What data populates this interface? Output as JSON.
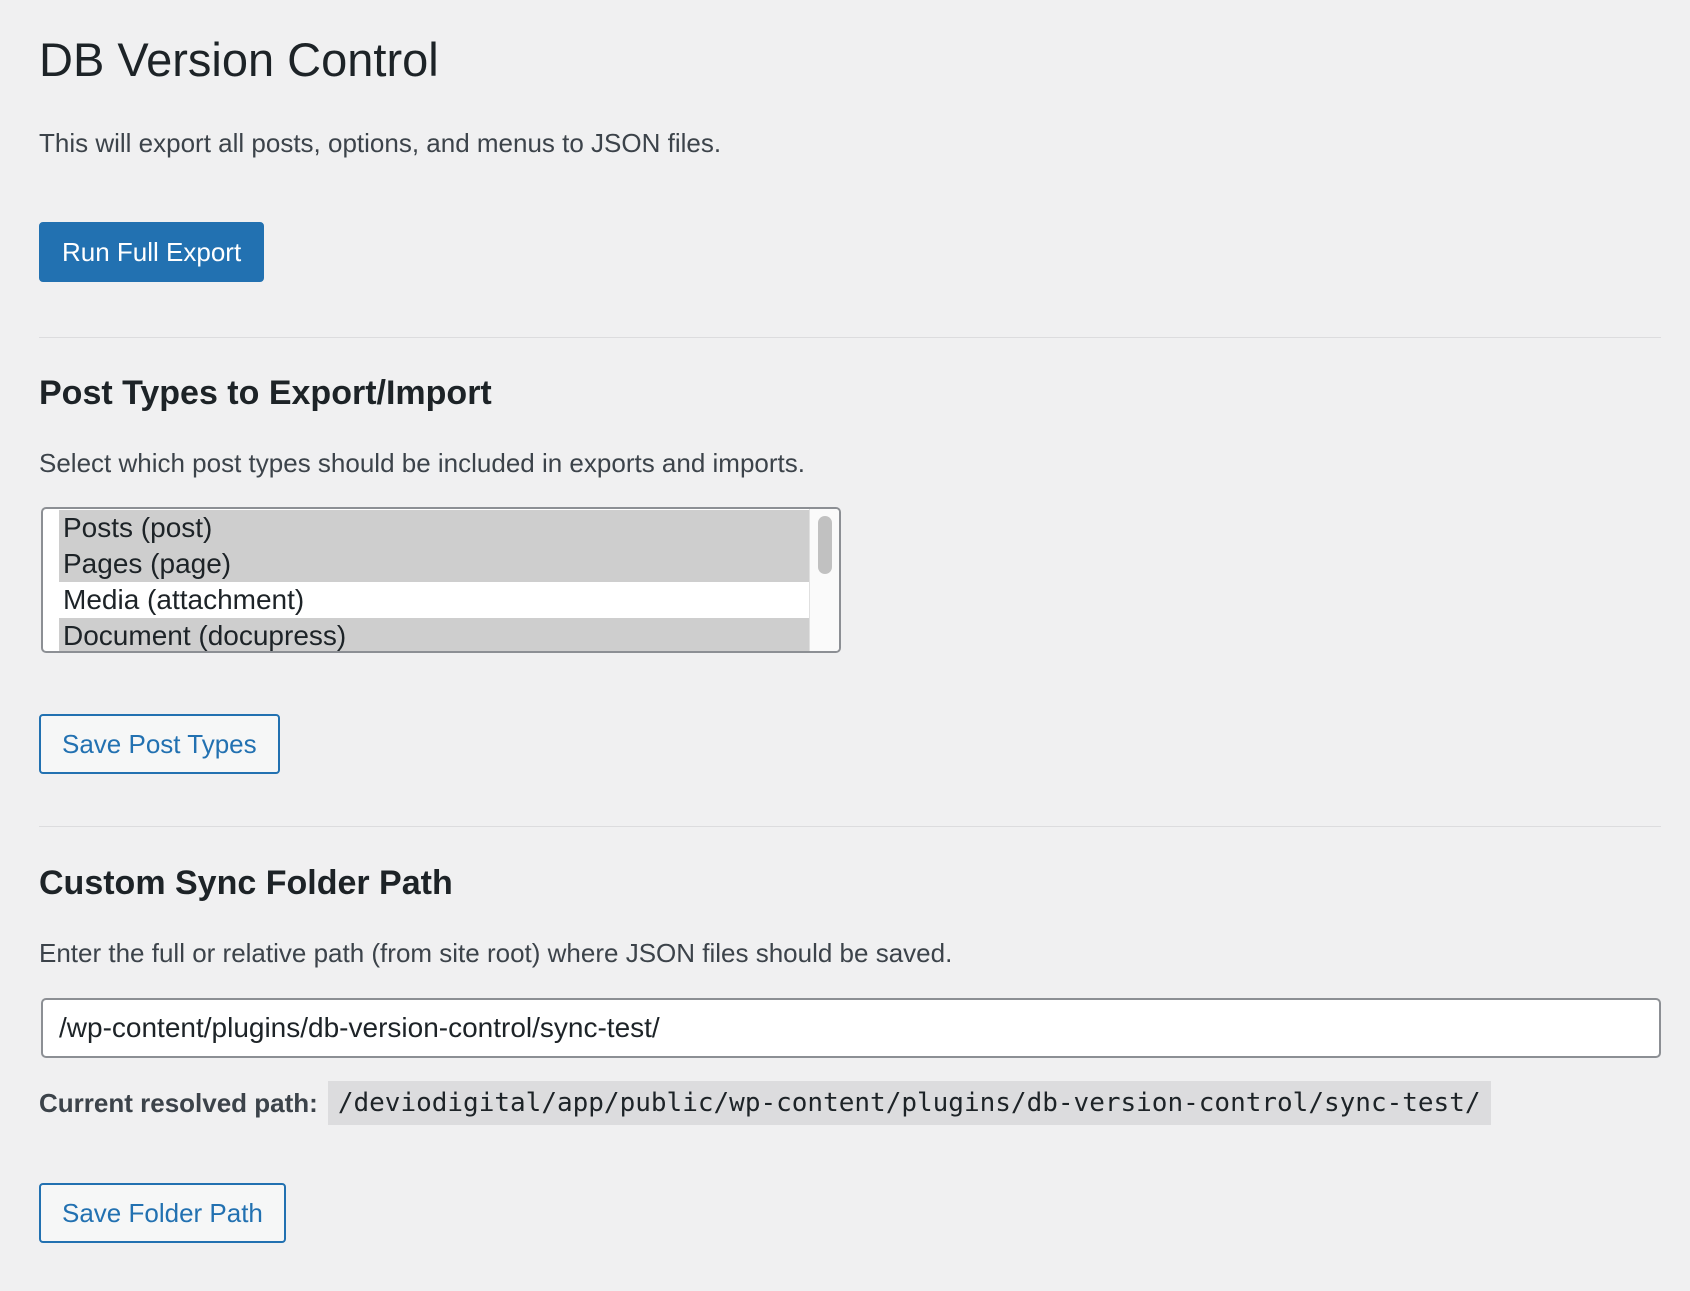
{
  "page": {
    "title": "DB Version Control",
    "description": "This will export all posts, options, and menus to JSON files.",
    "export_button": "Run Full Export"
  },
  "post_types": {
    "heading": "Post Types to Export/Import",
    "description": "Select which post types should be included in exports and imports.",
    "options": [
      {
        "label": "Posts (post)",
        "selected": true
      },
      {
        "label": "Pages (page)",
        "selected": true
      },
      {
        "label": "Media (attachment)",
        "selected": false
      },
      {
        "label": "Document (docupress)",
        "selected": true
      }
    ],
    "save_button": "Save Post Types"
  },
  "sync_folder": {
    "heading": "Custom Sync Folder Path",
    "description": "Enter the full or relative path (from site root) where JSON files should be saved.",
    "input_value": "/wp-content/plugins/db-version-control/sync-test/",
    "resolved_label": "Current resolved path:",
    "resolved_path": "/deviodigital/app/public/wp-content/plugins/db-version-control/sync-test/",
    "save_button": "Save Folder Path"
  },
  "colors": {
    "background": "#f0f0f1",
    "accent": "#2271b1",
    "text": "#1d2327",
    "selected_option": "#cecece"
  }
}
